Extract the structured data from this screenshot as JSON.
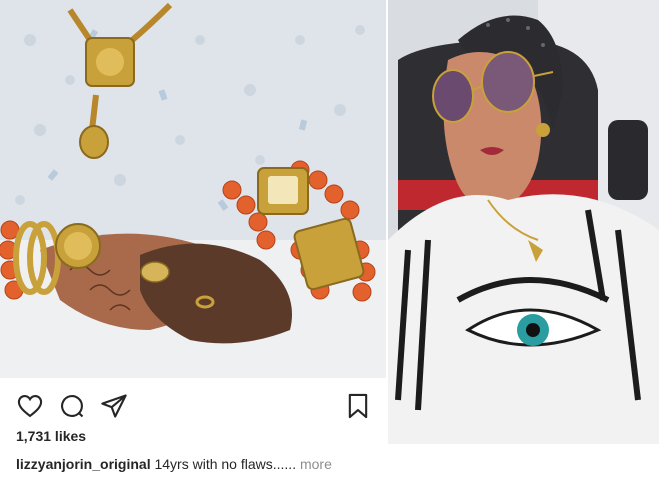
{
  "post": {
    "photo_alt": "hands with gold jewelry and coral beads",
    "likes": "1,731 likes",
    "username": "lizzyanjorin_original",
    "caption": "14yrs with no flaws......",
    "more": "more"
  },
  "icons": {
    "like": "heart-icon",
    "comment": "comment-icon",
    "share": "share-icon",
    "save": "bookmark-icon"
  },
  "selfie": {
    "photo_alt": "woman in sunglasses on airplane seat"
  },
  "colors": {
    "text": "#262626",
    "muted": "#8e8e8e",
    "coral": "#e2612c",
    "gold": "#c9a13b"
  }
}
